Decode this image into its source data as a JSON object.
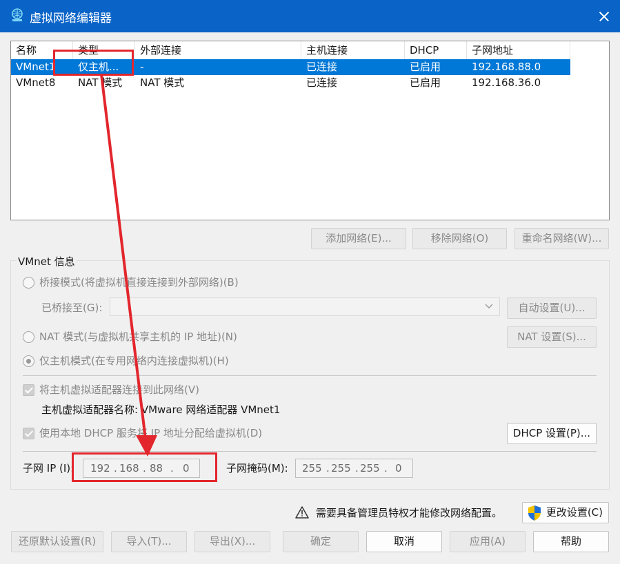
{
  "window": {
    "title": "虚拟网络编辑器",
    "icon": "network-editor-icon"
  },
  "network_list": {
    "columns": [
      "名称",
      "类型",
      "外部连接",
      "主机连接",
      "DHCP",
      "子网地址"
    ],
    "rows": [
      {
        "name": "VMnet1",
        "type": "仅主机...",
        "external": "-",
        "host": "已连接",
        "dhcp": "已启用",
        "subnet": "192.168.88.0",
        "selected": true
      },
      {
        "name": "VMnet8",
        "type": "NAT 模式",
        "external": "NAT 模式",
        "host": "已连接",
        "dhcp": "已启用",
        "subnet": "192.168.36.0",
        "selected": false
      }
    ]
  },
  "list_buttons": {
    "add": "添加网络(E)...",
    "remove": "移除网络(O)",
    "rename": "重命名网络(W)..."
  },
  "vmnet_info": {
    "group_title": "VMnet 信息",
    "bridge_radio": "桥接模式(将虚拟机直接连接到外部网络)(B)",
    "bridged_to_label": "已桥接至(G):",
    "bridged_to_value": "",
    "auto_settings": "自动设置(U)...",
    "nat_radio": "NAT 模式(与虚拟机共享主机的 IP 地址)(N)",
    "nat_settings": "NAT 设置(S)...",
    "hostonly_radio": "仅主机模式(在专用网络内连接虚拟机)(H)",
    "selected_mode": "hostonly",
    "connect_adapter_check": "将主机虚拟适配器连接到此网络(V)",
    "adapter_name_label": "主机虚拟适配器名称: VMware 网络适配器 VMnet1",
    "dhcp_check": "使用本地 DHCP 服务将 IP 地址分配给虚拟机(D)",
    "dhcp_settings": "DHCP 设置(P)...",
    "subnet_ip_label": "子网 IP (I):",
    "subnet_ip": [
      "192",
      "168",
      "88",
      "0"
    ],
    "subnet_mask_label": "子网掩码(M):",
    "subnet_mask": [
      "255",
      "255",
      "255",
      "0"
    ]
  },
  "admin": {
    "warning": "需要具备管理员特权才能修改网络配置。",
    "change_settings": "更改设置(C)"
  },
  "footer_buttons": {
    "restore": "还原默认设置(R)",
    "import": "导入(T)...",
    "export": "导出(X)...",
    "ok": "确定",
    "cancel": "取消",
    "apply": "应用(A)",
    "help": "帮助"
  },
  "colors": {
    "titlebar": "#0a64c8",
    "selection": "#0078d7",
    "annotation": "#e3262d"
  }
}
